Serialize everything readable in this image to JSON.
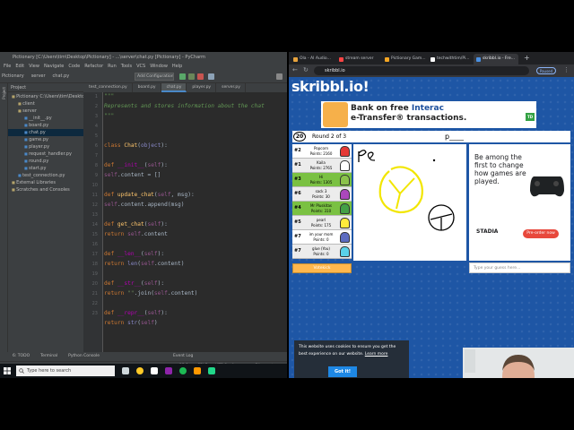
{
  "ide": {
    "window_title": "Pictionary [C:\\Users\\tim\\Desktop\\Pictionary] - ...\\server\\chat.py [Pictionary] - PyCharm",
    "menu": [
      "File",
      "Edit",
      "View",
      "Navigate",
      "Code",
      "Refactor",
      "Run",
      "Tools",
      "VCS",
      "Window",
      "Help"
    ],
    "breadcrumbs": [
      "Pictionary",
      "server",
      "chat.py"
    ],
    "run_config": "Add Configuration...",
    "project_label": "Project",
    "project_tree": [
      {
        "label": "Pictionary  C:\\Users\\tim\\Desktop\\Pictionary",
        "indent": 0,
        "selected": false
      },
      {
        "label": "client",
        "indent": 1,
        "selected": false
      },
      {
        "label": "server",
        "indent": 1,
        "selected": false
      },
      {
        "label": "__init__.py",
        "indent": 2,
        "selected": false
      },
      {
        "label": "board.py",
        "indent": 2,
        "selected": false
      },
      {
        "label": "chat.py",
        "indent": 2,
        "selected": true
      },
      {
        "label": "game.py",
        "indent": 2,
        "selected": false
      },
      {
        "label": "player.py",
        "indent": 2,
        "selected": false
      },
      {
        "label": "request_handler.py",
        "indent": 2,
        "selected": false
      },
      {
        "label": "round.py",
        "indent": 2,
        "selected": false
      },
      {
        "label": "start.py",
        "indent": 2,
        "selected": false
      },
      {
        "label": "test_connection.py",
        "indent": 1,
        "selected": false
      },
      {
        "label": "External Libraries",
        "indent": 0,
        "selected": false
      },
      {
        "label": "Scratches and Consoles",
        "indent": 0,
        "selected": false
      }
    ],
    "editor_tabs": [
      {
        "label": "test_connection.py",
        "active": false
      },
      {
        "label": "board.py",
        "active": false
      },
      {
        "label": "chat.py",
        "active": true
      },
      {
        "label": "player.py",
        "active": false
      },
      {
        "label": "server.py",
        "active": false
      }
    ],
    "line_numbers": [
      "1",
      "2",
      "3",
      "4",
      "5",
      "6",
      "7",
      "8",
      "9",
      "10",
      "11",
      "12",
      "13",
      "14",
      "15",
      "16",
      "17",
      "18",
      "19",
      "20",
      "21",
      "22",
      "23"
    ],
    "code_lines": [
      "    \"\"\"",
      "    Represents and stores information about the chat",
      "    \"\"\"",
      "",
      "",
      "class Chat(object):",
      "",
      "    def __init__(self):",
      "        self.content = []",
      "",
      "    def update_chat(self, msg):",
      "        self.content.append(msg)",
      "",
      "    def get_chat(self):",
      "        return self.content",
      "",
      "    def __len__(self):",
      "        return len(self.content)",
      "",
      "    def __str__(self):",
      "        return \"\".join(self.content)",
      "",
      "    def __repr__(self):",
      "        return str(self)",
      ""
    ],
    "bottom_tools": [
      "6: TODO",
      "Terminal",
      "Python Console",
      "Event Log"
    ],
    "status": {
      "position": "25:1",
      "line_sep": "CRLF",
      "encoding": "UTF-8",
      "indent": "4 spaces",
      "vcs": "Git: master"
    }
  },
  "taskbar": {
    "search_placeholder": "Type here to search"
  },
  "browser": {
    "tabs": [
      {
        "label": "Ola - AI Audio...",
        "favicon": "#e8a33d",
        "active": false
      },
      {
        "label": "stream server",
        "favicon": "#ff4444",
        "active": false
      },
      {
        "label": "Pictionary Gam...",
        "favicon": "#f5a623",
        "active": false
      },
      {
        "label": "techwithtim/Pi...",
        "favicon": "#ffffff",
        "active": false
      },
      {
        "label": "skribbl.io - Fre...",
        "favicon": "#4a90e2",
        "active": true
      }
    ],
    "url": "skribbl.io",
    "paused_label": "Paused"
  },
  "game": {
    "logo": "skribbl.io!",
    "top_ad": {
      "line1_pre": "Bank on free ",
      "line1_brand": "Interac",
      "line2": "e-Transfer® transactions.",
      "brand": "TD"
    },
    "timer": "20",
    "round": "Round 2 of 3",
    "word_hint": "p____",
    "players": [
      {
        "rank": "#2",
        "name": "Popcorn",
        "points": "Points: 2160",
        "highlight": false,
        "avatar": "#e53935"
      },
      {
        "rank": "#1",
        "name": "Kaila",
        "points": "Points: 2765",
        "highlight": false,
        "avatar": "#ffffff"
      },
      {
        "rank": "#3",
        "name": "Hi",
        "points": "Points: 1305",
        "highlight": true,
        "avatar": "#8bc34a"
      },
      {
        "rank": "#6",
        "name": "sack 3",
        "points": "Points: 30",
        "highlight": false,
        "avatar": "#ab47bc"
      },
      {
        "rank": "#4",
        "name": "Mr Pluskitas",
        "points": "Points: 310",
        "highlight": true,
        "avatar": "#43a047"
      },
      {
        "rank": "#5",
        "name": "pearl",
        "points": "Points: 175",
        "highlight": false,
        "avatar": "#ffeb3b"
      },
      {
        "rank": "#7",
        "name": "im your mom",
        "points": "Points: 0",
        "highlight": false,
        "avatar": "#5c6bc0"
      },
      {
        "rank": "#7",
        "name": "glue (You)",
        "points": "Points: 0",
        "highlight": false,
        "avatar": "#5ad1e8"
      }
    ],
    "votekick": "Votekick",
    "guess_placeholder": "Type your guess here...",
    "right_ad": {
      "text": "Be among the first to change how games are played.",
      "button": "Pre-order now",
      "brand": "STADIA"
    },
    "cookie": {
      "text": "This website uses cookies to ensure you get the best experience on our website.",
      "link": "Learn more",
      "button": "Got it!"
    }
  }
}
